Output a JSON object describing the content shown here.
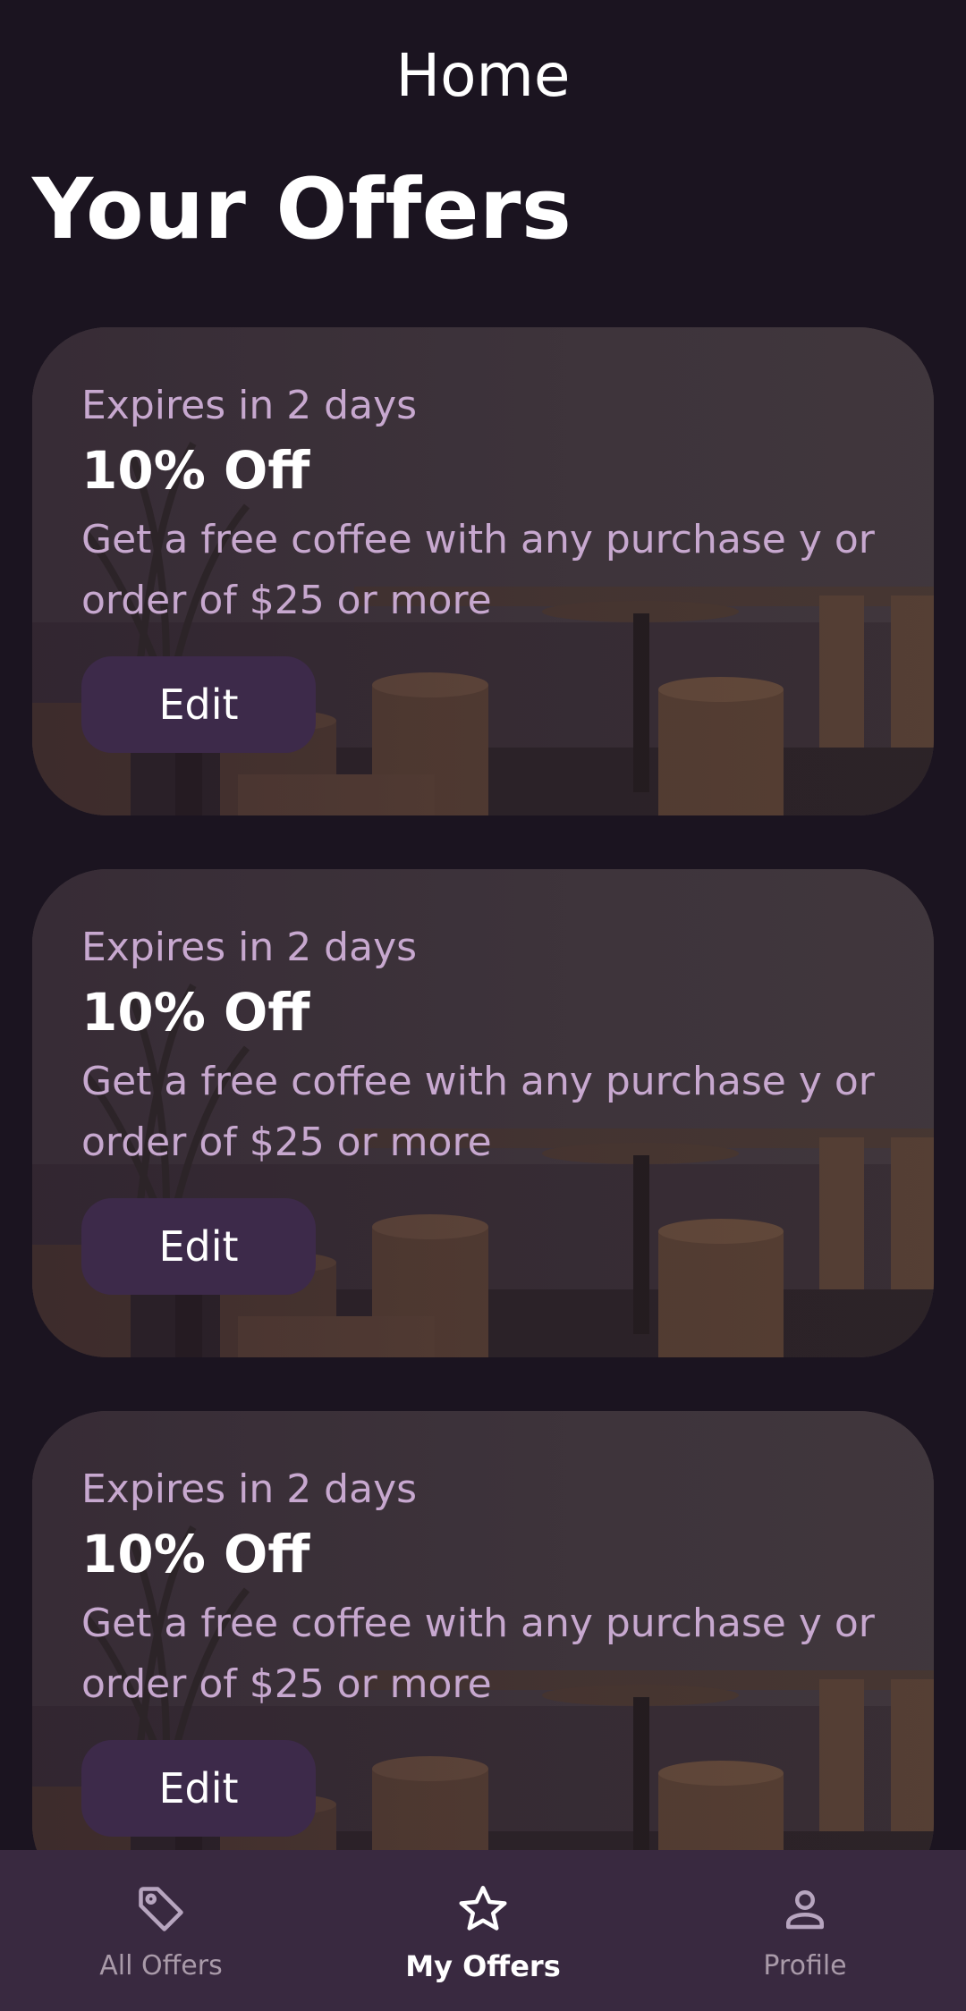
{
  "header": {
    "title": "Home"
  },
  "section": {
    "title": "Your Offers"
  },
  "offers": [
    {
      "expires": "Expires in 2 days",
      "title": "10% Off",
      "description": "Get a free coffee with any purchase y or order of $25 or more",
      "button_label": "Edit"
    },
    {
      "expires": "Expires in 2 days",
      "title": "10% Off",
      "description": "Get a free coffee with any purchase y or order of $25 or more",
      "button_label": "Edit"
    },
    {
      "expires": "Expires in 2 days",
      "title": "10% Off",
      "description": "Get a free coffee with any purchase y or order of $25 or more",
      "button_label": "Edit"
    }
  ],
  "bottom_nav": {
    "items": [
      {
        "label": "All Offers",
        "icon": "tag-icon",
        "active": false
      },
      {
        "label": "My Offers",
        "icon": "star-icon",
        "active": true
      },
      {
        "label": "Profile",
        "icon": "person-icon",
        "active": false
      }
    ]
  },
  "colors": {
    "background": "#1b1420",
    "nav_background": "#392940",
    "button_background": "#3d2a4a",
    "secondary_text": "#c7a8cf"
  }
}
